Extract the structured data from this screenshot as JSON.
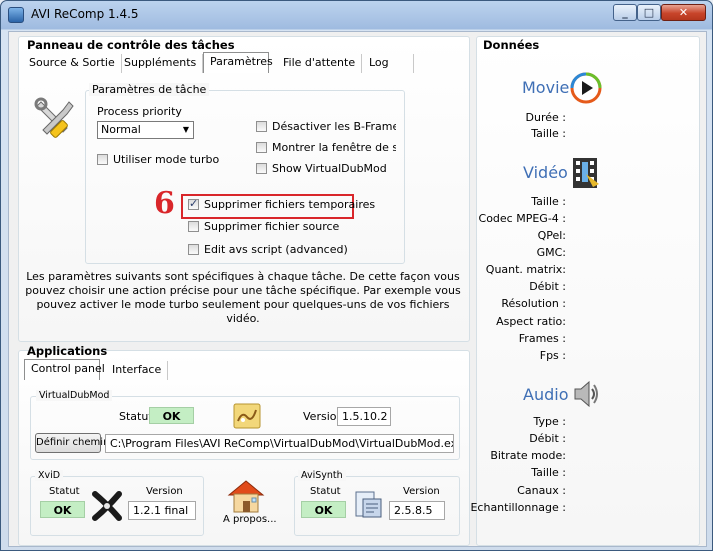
{
  "window": {
    "title": "AVI ReComp  1.4.5"
  },
  "left": {
    "panel_title": "Panneau de contrôle des tâches",
    "tabs": [
      {
        "label": "Source & Sortie"
      },
      {
        "label": "Suppléments"
      },
      {
        "label": "Paramètres"
      },
      {
        "label": "File d'attente"
      },
      {
        "label": "Log"
      }
    ],
    "task_group": {
      "title": "Paramètres de tâche",
      "priority_label": "Process priority",
      "priority_value": "Normal",
      "turbo_label": "Utiliser mode turbo",
      "right_options": [
        {
          "label": "Désactiver les B-Frames",
          "checked": false
        },
        {
          "label": "Montrer la fenêtre de statu",
          "checked": false
        },
        {
          "label": "Show VirtualDubMod",
          "checked": false
        }
      ],
      "bottom_options": [
        {
          "label": "Supprimer fichiers temporaires",
          "checked": true
        },
        {
          "label": "Supprimer fichier source",
          "checked": false
        },
        {
          "label": "Edit avs script (advanced)",
          "checked": false
        }
      ],
      "annotation": "6"
    },
    "info_lines": [
      "Les paramètres suivants sont spécifiques à chaque tâche. De cette façon vous",
      "pouvez choisir une action précise  pour une tâche spécifique. Par exemple vous",
      "pouvez activer le mode turbo seulement pour quelques-uns de vos fichiers vidéo."
    ]
  },
  "applications": {
    "title": "Applications",
    "tabs": [
      {
        "label": "Control panel"
      },
      {
        "label": "Interface"
      }
    ],
    "virtualdubmod": {
      "title": "VirtualDubMod",
      "status_label": "Statut",
      "status_value": "OK",
      "version_label": "Version",
      "version_value": "1.5.10.2",
      "set_path_button": "Définir chemin",
      "path_value": "C:\\Program Files\\AVI ReComp\\VirtualDubMod\\VirtualDubMod.exe"
    },
    "xvid": {
      "title": "XviD",
      "status_label": "Statut",
      "status_value": "OK",
      "version_label": "Version",
      "version_value": "1.2.1 final"
    },
    "about_label": "A propos...",
    "avisynth": {
      "title": "AviSynth",
      "status_label": "Statut",
      "status_value": "OK",
      "version_label": "Version",
      "version_value": "2.5.8.5"
    }
  },
  "right": {
    "title": "Données",
    "movie": {
      "heading": "Movie",
      "labels": [
        "Durée :",
        "Taille :"
      ]
    },
    "video": {
      "heading": "Vidéo",
      "labels": [
        "Taille :",
        "Codec MPEG-4 :",
        "QPel:",
        "GMC:",
        "Quant. matrix:",
        "Débit :",
        "Résolution :",
        "Aspect ratio:",
        "Frames :",
        "Fps :"
      ]
    },
    "audio": {
      "heading": "Audio",
      "labels": [
        "Type :",
        "Débit :",
        "Bitrate mode:",
        "Taille :",
        "Canaux :",
        "Echantillonnage :"
      ]
    }
  },
  "colors": {
    "accent_heading": "#3f6fb5",
    "annotation_red": "#d9262a",
    "ok_green": "#c4eec4"
  }
}
